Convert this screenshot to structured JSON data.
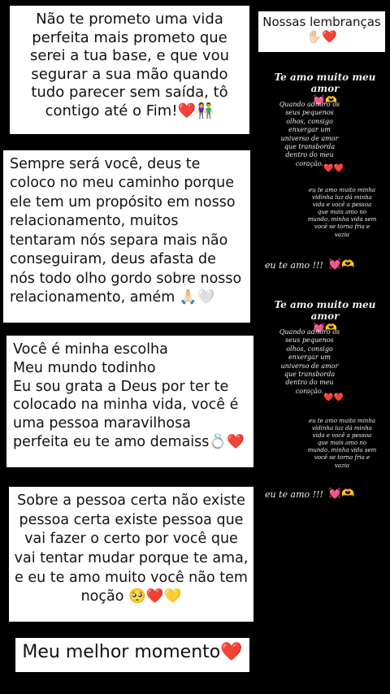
{
  "cards": {
    "card1": "Não te prometo uma vida perfeita mais prometo que serei a tua base, e que vou segurar a sua mão quando tudo parecer sem saída, tô contigo até o Fim!❤️👫",
    "card2": "Sempre será você, deus te coloco no meu caminho porque ele tem um propósito em nosso relacionamento, muitos tentaram nós separa mais não conseguiram, deus afasta de nós todo olho gordo sobre nosso relacionamento, amém 🙏🏻🤍",
    "card3": "Você é minha escolha\nMeu mundo todinho\nEu sou grata a Deus por ter te colocado na minha vida, você é uma pessoa maravilhosa perfeita eu te amo demaiss💍❤️",
    "card4": "Sobre a pessoa certa não existe pessoa certa existe pessoa que vai fazer o certo por você que vai tentar mudar porque te ama, e eu te amo muito você não tem noção 🥺❤️💛",
    "card5": "Meu melhor momento❤️"
  },
  "memories": {
    "title": "Nossas lembranças",
    "emoji": "✋🏻❤️"
  },
  "panel": {
    "title": "Te amo muito meu amor",
    "title_emoji": "💓🫶",
    "poem1": "Quando admiro os seus pequenos olhos, consigo enxergar um universo de amor que transborda dentro do meu coração.",
    "hearts": "❤️❤️",
    "poem2": "eu te amo muito minha vidinha luz dá minha vida e você a pessoa que mais amo no mundo, minha vida sem você se torna fria e vazia",
    "footer": "eu te amo !!!",
    "footer_emoji": "💓🫶"
  }
}
